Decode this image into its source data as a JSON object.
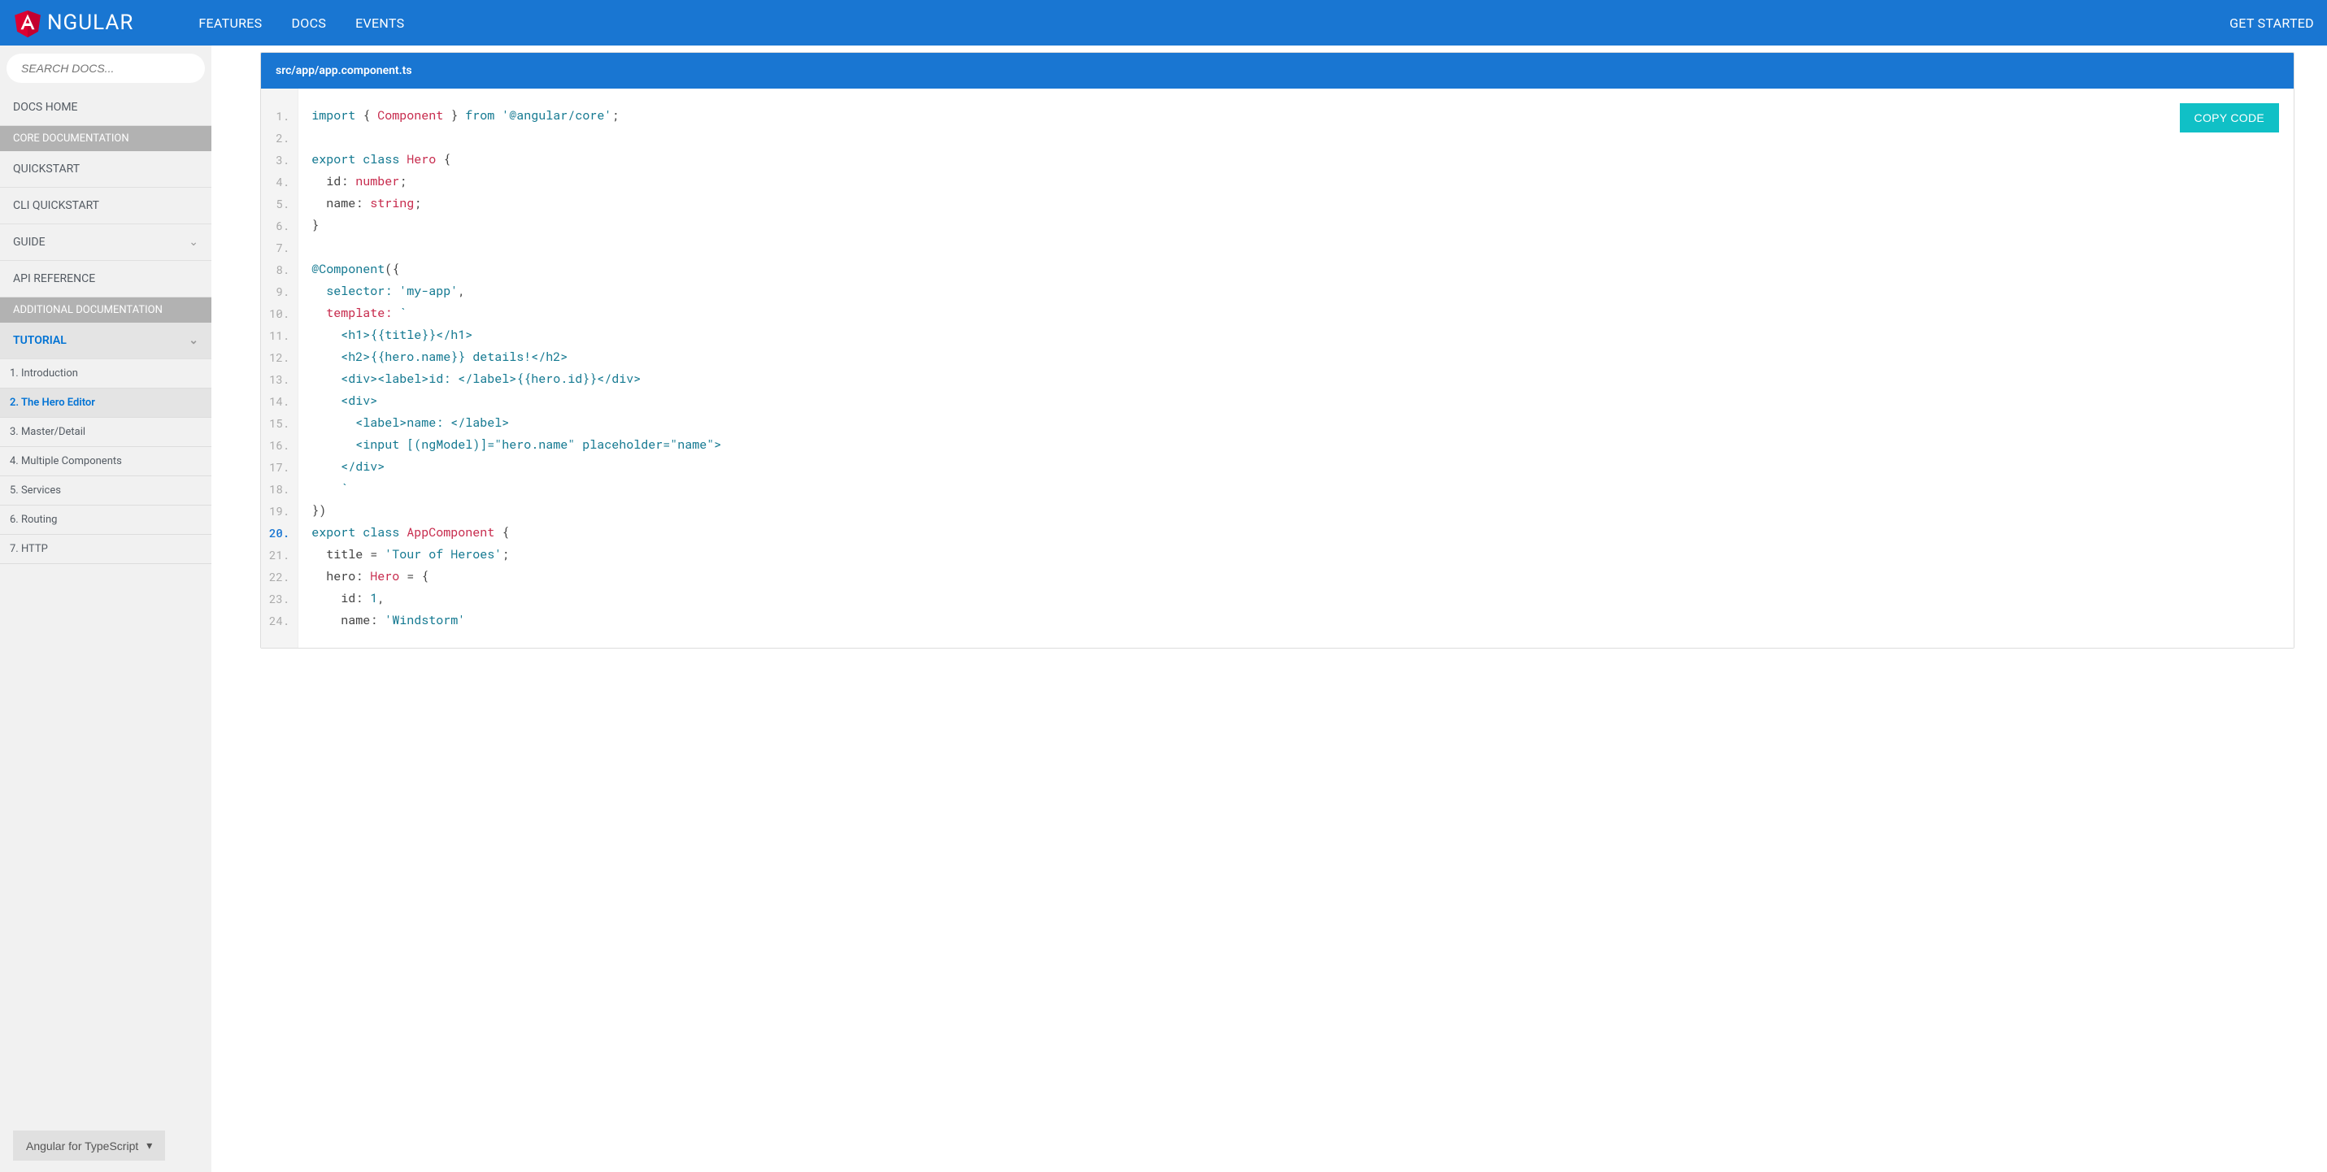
{
  "header": {
    "brand": "NGULAR",
    "links": [
      "FEATURES",
      "DOCS",
      "EVENTS"
    ],
    "cta": "GET STARTED"
  },
  "sidebar": {
    "search_placeholder": "SEARCH DOCS...",
    "sections": {
      "docs_home": "DOCS HOME",
      "core_header": "CORE DOCUMENTATION",
      "quickstart": "QUICKSTART",
      "cli_quickstart": "CLI QUICKSTART",
      "guide": "GUIDE",
      "api_reference": "API REFERENCE",
      "additional_header": "ADDITIONAL DOCUMENTATION",
      "tutorial": "TUTORIAL",
      "tutorial_items": {
        "i1": "1. Introduction",
        "i2": "2. The Hero Editor",
        "i3": "3. Master/Detail",
        "i4": "4. Multiple Components",
        "i5": "5. Services",
        "i6": "6. Routing",
        "i7": "7. HTTP"
      }
    },
    "lang_selector": "Angular for TypeScript"
  },
  "code": {
    "filename": "src/app/app.component.ts",
    "copy_label": "COPY CODE",
    "lines": [
      {
        "n": "1."
      },
      {
        "n": "2."
      },
      {
        "n": "3."
      },
      {
        "n": "4."
      },
      {
        "n": "5."
      },
      {
        "n": "6."
      },
      {
        "n": "7."
      },
      {
        "n": "8."
      },
      {
        "n": "9."
      },
      {
        "n": "10."
      },
      {
        "n": "11."
      },
      {
        "n": "12."
      },
      {
        "n": "13."
      },
      {
        "n": "14."
      },
      {
        "n": "15."
      },
      {
        "n": "16."
      },
      {
        "n": "17."
      },
      {
        "n": "18."
      },
      {
        "n": "19."
      },
      {
        "n": "20."
      },
      {
        "n": "21."
      },
      {
        "n": "22."
      },
      {
        "n": "23."
      },
      {
        "n": "24."
      }
    ],
    "source": {
      "l1_import": "import",
      "l1_lbrace": " { ",
      "l1_component": "Component",
      "l1_rbrace": " } ",
      "l1_from": "from",
      "l1_pkg": " '@angular/core'",
      "l1_semi": ";",
      "l3_export": "export",
      "l3_class": " class",
      "l3_hero": " Hero",
      "l3_brace": " {",
      "l4": "  id: ",
      "l4_type": "number",
      "l4_semi": ";",
      "l5": "  name: ",
      "l5_type": "string",
      "l5_semi": ";",
      "l6": "}",
      "l8_decorator": "@Component",
      "l8_paren": "({",
      "l9_key": "  selector:",
      "l9_val": " 'my-app'",
      "l9_comma": ",",
      "l10_key": "  template:",
      "l10_tick": " `",
      "l11": "    <h1>{{title}}</h1>",
      "l12": "    <h2>{{hero.name}} details!</h2>",
      "l13": "    <div><label>id: </label>{{hero.id}}</div>",
      "l14": "    <div>",
      "l15": "      <label>name: </label>",
      "l16": "      <input [(ngModel)]=\"hero.name\" placeholder=\"name\">",
      "l17": "    </div>",
      "l18": "    `",
      "l19": "})",
      "l20_export": "export",
      "l20_class": " class",
      "l20_name": " AppComponent",
      "l20_brace": " {",
      "l21_pre": "  title = ",
      "l21_val": "'Tour of Heroes'",
      "l21_semi": ";",
      "l22_pre": "  hero: ",
      "l22_type": "Hero",
      "l22_rest": " = {",
      "l23_pre": "    id: ",
      "l23_val": "1",
      "l23_comma": ",",
      "l24_pre": "    name: ",
      "l24_val": "'Windstorm'"
    }
  }
}
